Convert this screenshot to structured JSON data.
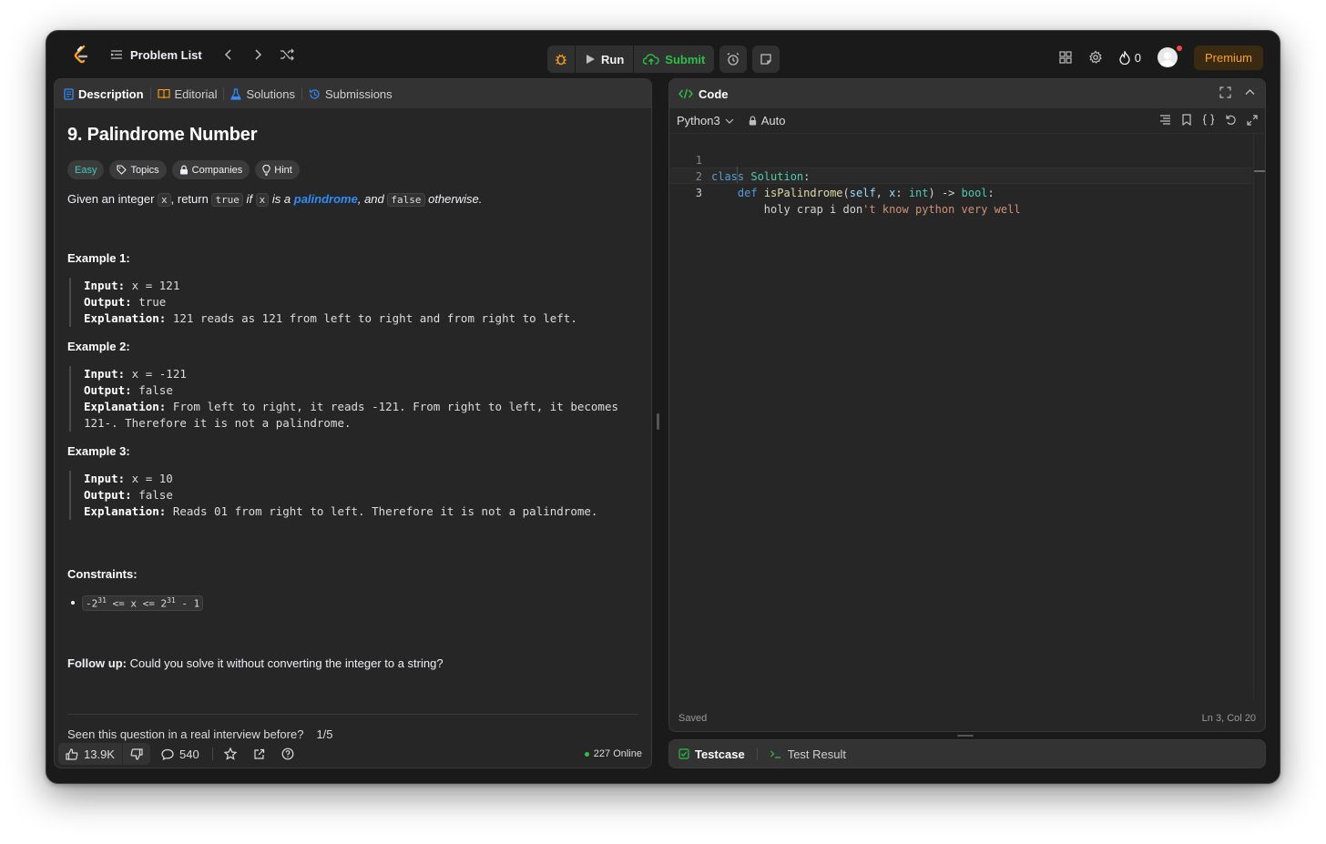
{
  "topbar": {
    "problem_list": "Problem List",
    "run": "Run",
    "submit": "Submit",
    "streak": "0",
    "premium": "Premium"
  },
  "left_tabs": [
    {
      "label": "Description",
      "icon": "description-icon"
    },
    {
      "label": "Editorial",
      "icon": "book-icon"
    },
    {
      "label": "Solutions",
      "icon": "flask-icon"
    },
    {
      "label": "Submissions",
      "icon": "history-icon"
    }
  ],
  "problem": {
    "title": "9. Palindrome Number",
    "tags": [
      "Easy",
      "Topics",
      "Companies",
      "Hint"
    ],
    "statement": {
      "p1": "Given an integer ",
      "x": "x",
      "p2": ", return ",
      "true": "true",
      "p3": " if ",
      "x2": "x",
      "p4": " is a ",
      "link": "palindrome",
      "p5": ", and ",
      "false": "false",
      "p6": " otherwise."
    },
    "examples": [
      {
        "title": "Example 1:",
        "input_label": "Input:",
        "input": " x = 121",
        "output_label": "Output:",
        "output": " true",
        "expl_label": "Explanation:",
        "expl": " 121 reads as 121 from left to right and from right to left."
      },
      {
        "title": "Example 2:",
        "input_label": "Input:",
        "input": " x = -121",
        "output_label": "Output:",
        "output": " false",
        "expl_label": "Explanation:",
        "expl": " From left to right, it reads -121. From right to left, it becomes",
        "expl2": "121-. Therefore it is not a palindrome."
      },
      {
        "title": "Example 3:",
        "input_label": "Input:",
        "input": " x = 10",
        "output_label": "Output:",
        "output": " false",
        "expl_label": "Explanation:",
        "expl": " Reads 01 from right to left. Therefore it is not a palindrome."
      }
    ],
    "constraints_title": "Constraints:",
    "constraint": {
      "a": "-2",
      "a_exp": "31",
      "mid": " <= x <= 2",
      "b_exp": "31",
      "end": " - 1"
    },
    "followup_label": "Follow up:",
    "followup": " Could you solve it without converting the integer to a string?",
    "seen": "Seen this question in a real interview before?",
    "seen_count": "1/5"
  },
  "footer": {
    "likes": "13.9K",
    "comments": "540",
    "online": "227 Online"
  },
  "code_panel": {
    "title": "Code",
    "language": "Python3",
    "mode": "Auto",
    "lines": [
      {
        "n": "1"
      },
      {
        "n": "2"
      },
      {
        "n": "3"
      }
    ],
    "code": {
      "l1_kw": "class",
      "l1_cls": "Solution",
      "l1_end": ":",
      "l2_kw": "def",
      "l2_fn": "isPalindrome",
      "l2_a": "(",
      "l2_self": "self",
      "l2_b": ", ",
      "l2_x": "x",
      "l2_c": ": ",
      "l2_int": "int",
      "l2_d": ") -> ",
      "l2_bool": "bool",
      "l2_e": ":",
      "l3_a": "holy crap i don",
      "l3_str": "'t know python very well"
    },
    "saved": "Saved",
    "cursor": "Ln 3, Col 20"
  },
  "test_panel": {
    "testcase": "Testcase",
    "result": "Test Result"
  },
  "colors": {
    "accent_orange": "#ffa116",
    "submit_green": "#28c244",
    "easy_teal": "#46c6c2",
    "link_blue": "#2e8cfc"
  }
}
